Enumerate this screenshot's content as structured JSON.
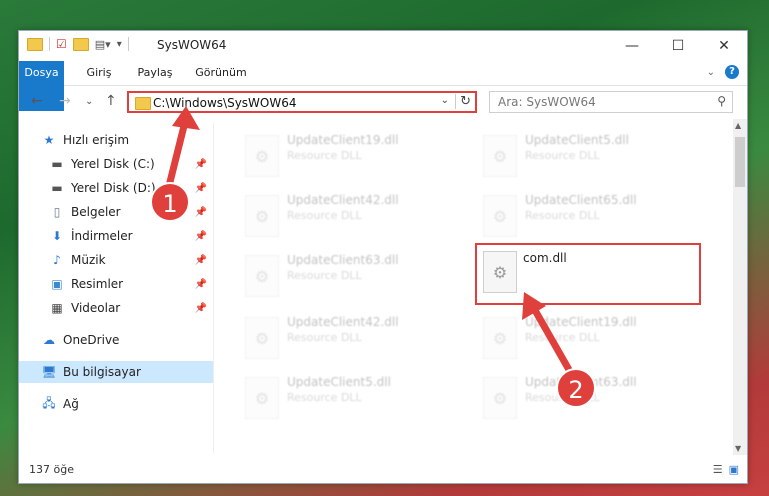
{
  "window": {
    "title": "SysWOW64",
    "controls": {
      "minimize": "—",
      "maximize": "☐",
      "close": "✕"
    }
  },
  "ribbon": {
    "tabs": [
      "Dosya",
      "Giriş",
      "Paylaş",
      "Görünüm"
    ]
  },
  "nav": {
    "address": "C:\\Windows\\SysWOW64",
    "search_placeholder": "Ara: SysWOW64"
  },
  "sidebar": {
    "items": [
      {
        "label": "Hızlı erişim",
        "icon": "star-icon"
      },
      {
        "label": "Yerel Disk (C:)",
        "icon": "drive-icon"
      },
      {
        "label": "Yerel Disk (D:)",
        "icon": "drive-icon"
      },
      {
        "label": "Belgeler",
        "icon": "documents-icon"
      },
      {
        "label": "İndirmeler",
        "icon": "download-icon"
      },
      {
        "label": "Müzik",
        "icon": "music-icon"
      },
      {
        "label": "Resimler",
        "icon": "pictures-icon"
      },
      {
        "label": "Videolar",
        "icon": "video-icon"
      },
      {
        "label": "OneDrive",
        "icon": "cloud-icon"
      },
      {
        "label": "Bu bilgisayar",
        "icon": "computer-icon"
      },
      {
        "label": "Ağ",
        "icon": "network-icon"
      }
    ]
  },
  "files": [
    {
      "name": "UpdateClient19.dll",
      "type": "Resource DLL"
    },
    {
      "name": "UpdateClient5.dll",
      "type": "Resource DLL"
    },
    {
      "name": "UpdateClient42.dll",
      "type": "Resource DLL"
    },
    {
      "name": "UpdateClient65.dll",
      "type": "Resource DLL"
    },
    {
      "name": "UpdateClient63.dll",
      "type": "Resource DLL"
    },
    {
      "name": "com.dll",
      "type": ""
    },
    {
      "name": "UpdateClient42.dll",
      "type": "Resource DLL"
    },
    {
      "name": "UpdateClient19.dll",
      "type": "Resource DLL"
    },
    {
      "name": "UpdateClient5.dll",
      "type": "Resource DLL"
    },
    {
      "name": "UpdateClient63.dll",
      "type": "Resource DLL"
    }
  ],
  "status": {
    "count": "137 öğe"
  },
  "annotations": {
    "badge1": "1",
    "badge2": "2",
    "color": "#e0403c"
  }
}
